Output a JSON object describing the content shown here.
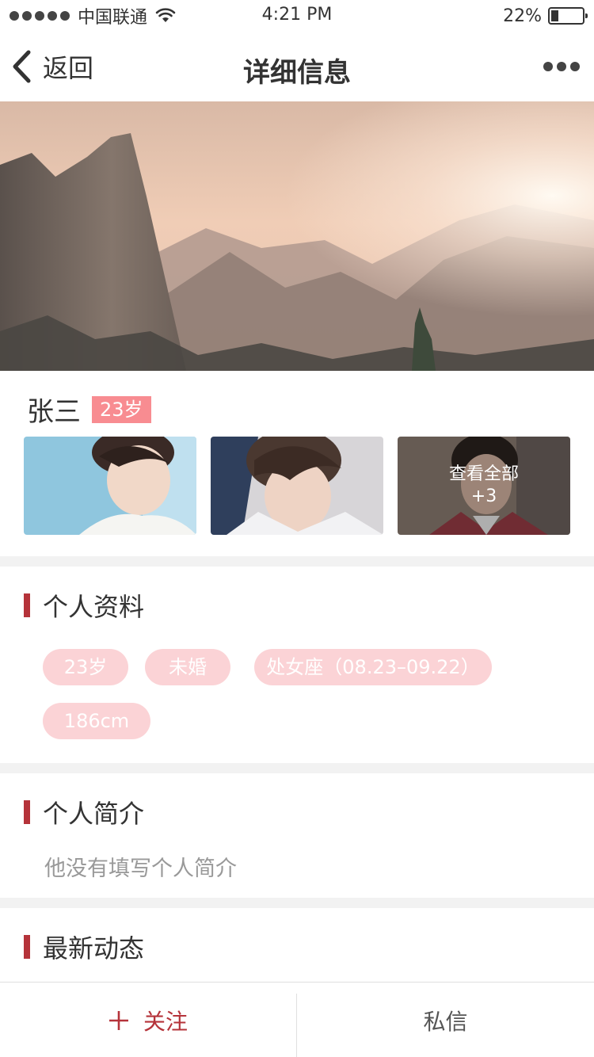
{
  "status_bar": {
    "carrier": "中国联通",
    "time": "4:21 PM",
    "battery_percent": "22%",
    "battery_level": 0.22,
    "signal_icon": "signal-dots-icon",
    "wifi_icon": "wifi-icon"
  },
  "nav": {
    "back_label": "返回",
    "title": "详细信息",
    "more_icon": "more-dots-icon"
  },
  "profile": {
    "name": "张三",
    "age_badge": "23岁",
    "photos": [
      {
        "kind": "portrait-photo"
      },
      {
        "kind": "portrait-photo"
      },
      {
        "kind": "portrait-photo",
        "overlay_label": "查看全部",
        "overlay_count": "+3"
      }
    ]
  },
  "sections": {
    "personal_info": {
      "title": "个人资料",
      "tags": [
        "23岁",
        "未婚",
        "处女座（08.23–09.22）",
        "186cm"
      ]
    },
    "bio": {
      "title": "个人简介",
      "text": "他没有填写个人简介"
    },
    "moments": {
      "title": "最新动态"
    }
  },
  "bottom_bar": {
    "follow_label": "关注",
    "message_label": "私信"
  },
  "colors": {
    "accent": "#b5333a",
    "badge": "#f88c91",
    "tag_bg": "#fbd3d6",
    "divider": "#f2f2f2"
  }
}
